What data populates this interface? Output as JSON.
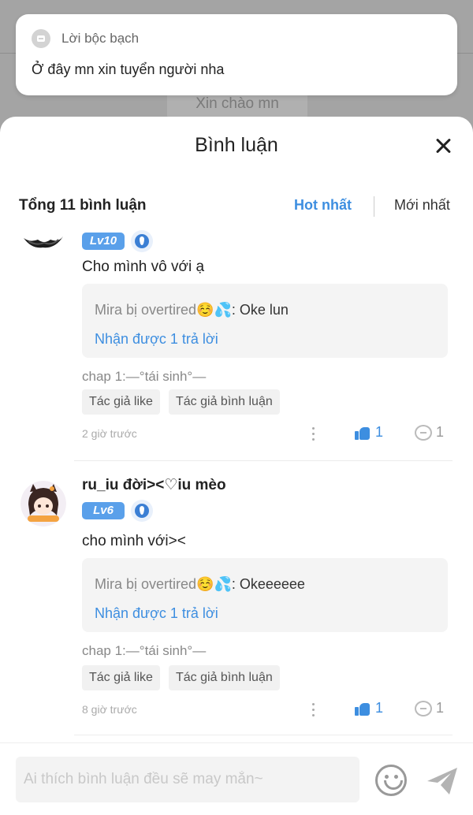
{
  "background": {
    "greeting": "Xin chào mn"
  },
  "notice": {
    "title": "Lời bộc bạch",
    "text": "Ở đây mn xin tuyển người nha"
  },
  "sheet": {
    "title": "Bình luận",
    "total": "Tổng 11 bình luận",
    "sort": {
      "hot": "Hot nhất",
      "newest": "Mới nhất"
    }
  },
  "comments": [
    {
      "level": "Lv10",
      "text": "Cho mình vô với ạ",
      "reply_user": "Mira bị overtired☺️💦",
      "reply_text": ": Oke lun",
      "reply_more": "Nhận được 1 trả lời",
      "chap": "chap 1:—°tái sinh°—",
      "tags": [
        "Tác giả like",
        "Tác giả bình luận"
      ],
      "time": "2 giờ trước",
      "likes": "1",
      "replies": "1"
    },
    {
      "name": "ru_iu đời><♡iu mèo",
      "level": "Lv6",
      "text": "cho mình với><",
      "reply_user": "Mira bị overtired☺️💦",
      "reply_text": ": Okeeeeee",
      "reply_more": "Nhận được 1 trả lời",
      "chap": "chap 1:—°tái sinh°—",
      "tags": [
        "Tác giả like",
        "Tác giả bình luận"
      ],
      "time": "8 giờ trước",
      "likes": "1",
      "replies": "1"
    }
  ],
  "composer": {
    "placeholder": "Ai thích bình luận đều sẽ may mắn~"
  },
  "colors": {
    "accent": "#3d8ee0",
    "badge": "#5aa0ea"
  }
}
